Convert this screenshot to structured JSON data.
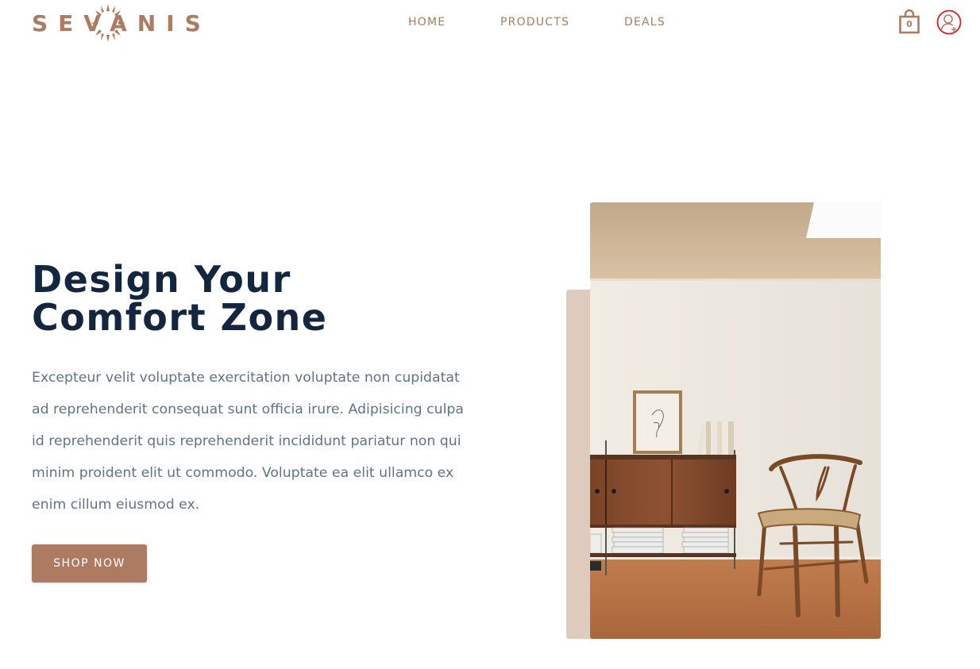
{
  "brand": {
    "name": "SEVANIS",
    "color": "#ad7b62"
  },
  "nav": {
    "items": [
      "HOME",
      "PRODUCTS",
      "DEALS"
    ]
  },
  "header": {
    "cart_icon": "shopping-bag-icon",
    "cart_count": "0",
    "user_icon": "user-add-icon"
  },
  "hero": {
    "title_lines": [
      "Design Your",
      "Comfort Zone"
    ],
    "body_lines": [
      "Excepteur velit voluptate exercitation voluptate non cupidatat",
      "ad reprehenderit consequat sunt officia irure. Adipisicing culpa",
      "id reprehenderit quis reprehenderit incididunt pariatur non qui",
      "minim proident elit ut commodo. Voluptate ea elit ullamco ex",
      "enim cillum eiusmod ex."
    ],
    "button_label": "SHOP NOW",
    "image_subject": "room-with-sideboard-and-wooden-chair"
  },
  "colors": {
    "accent": "#ad7b62",
    "heading": "#13263f",
    "body_text": "#5f7489",
    "accent_block": "#dfcbbe"
  }
}
